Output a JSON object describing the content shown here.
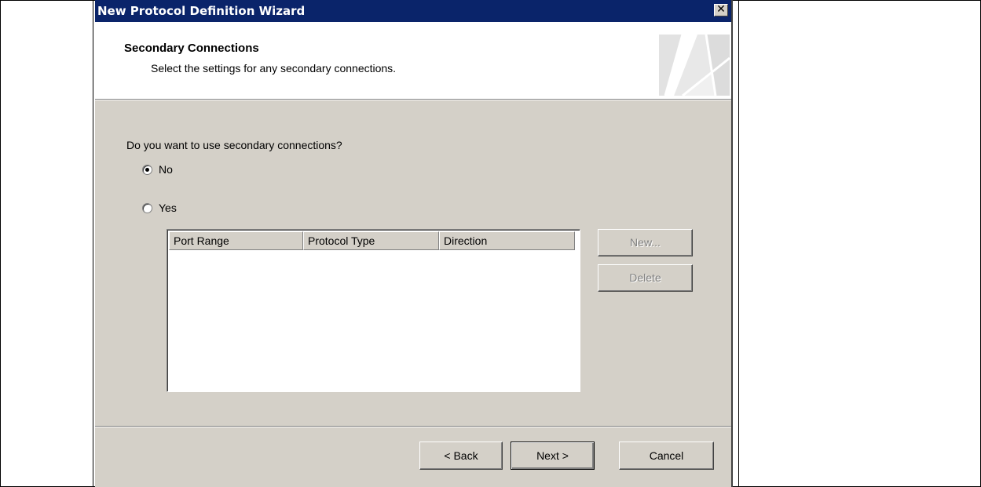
{
  "window": {
    "title": "New Protocol Definition Wizard",
    "close_glyph": "✕"
  },
  "header": {
    "title": "Secondary Connections",
    "subtitle": "Select the settings for any secondary connections.",
    "graphic_icon": "wizard-banner-graphic"
  },
  "body": {
    "question": "Do you want to use secondary connections?",
    "options": [
      {
        "label": "No",
        "checked": true
      },
      {
        "label": "Yes",
        "checked": false
      }
    ],
    "table": {
      "columns": [
        "Port Range",
        "Protocol Type",
        "Direction"
      ],
      "rows": []
    },
    "buttons": {
      "new_label": "New...",
      "delete_label": "Delete"
    }
  },
  "footer": {
    "back_label": "< Back",
    "next_label": "Next >",
    "cancel_label": "Cancel"
  },
  "colors": {
    "titlebar": "#0a246a",
    "dialog_face": "#d4d0c8",
    "disabled_text": "#808080"
  }
}
